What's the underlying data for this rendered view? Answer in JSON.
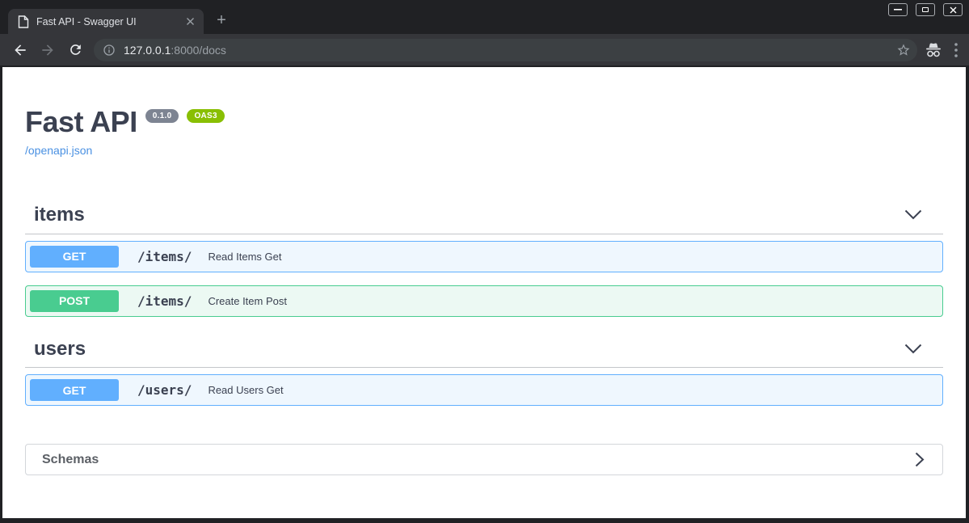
{
  "window": {
    "title": "Fast API - Swagger UI",
    "icons": {
      "controls": [
        "minimize-icon",
        "maximize-icon",
        "close-icon"
      ],
      "tab": [
        "document-favicon-icon",
        "tab-close-icon",
        "new-tab-plus-icon"
      ],
      "toolbar": [
        "back-icon",
        "forward-icon",
        "reload-icon",
        "info-icon",
        "star-icon",
        "incognito-icon",
        "kebab-menu-icon"
      ]
    }
  },
  "tab": {
    "title": "Fast API - Swagger UI",
    "new_tab": "+"
  },
  "toolbar": {
    "url_host": "127.0.0.1",
    "url_rest": ":8000/docs"
  },
  "api": {
    "title": "Fast API",
    "version": "0.1.0",
    "oas": "OAS3",
    "spec_link": "/openapi.json"
  },
  "sections": [
    {
      "name": "items",
      "operations": [
        {
          "method": "GET",
          "path": "/items/",
          "summary": "Read Items Get"
        },
        {
          "method": "POST",
          "path": "/items/",
          "summary": "Create Item Post"
        }
      ]
    },
    {
      "name": "users",
      "operations": [
        {
          "method": "GET",
          "path": "/users/",
          "summary": "Read Users Get"
        }
      ]
    }
  ],
  "schemas": {
    "label": "Schemas"
  },
  "colors": {
    "get": "#61affe",
    "post": "#49cc90",
    "link": "#4990e2",
    "version_badge": "#7d8492",
    "oas_badge": "#89bf04",
    "heading": "#3b4151",
    "frame": "#202124",
    "toolbar": "#35363a"
  }
}
